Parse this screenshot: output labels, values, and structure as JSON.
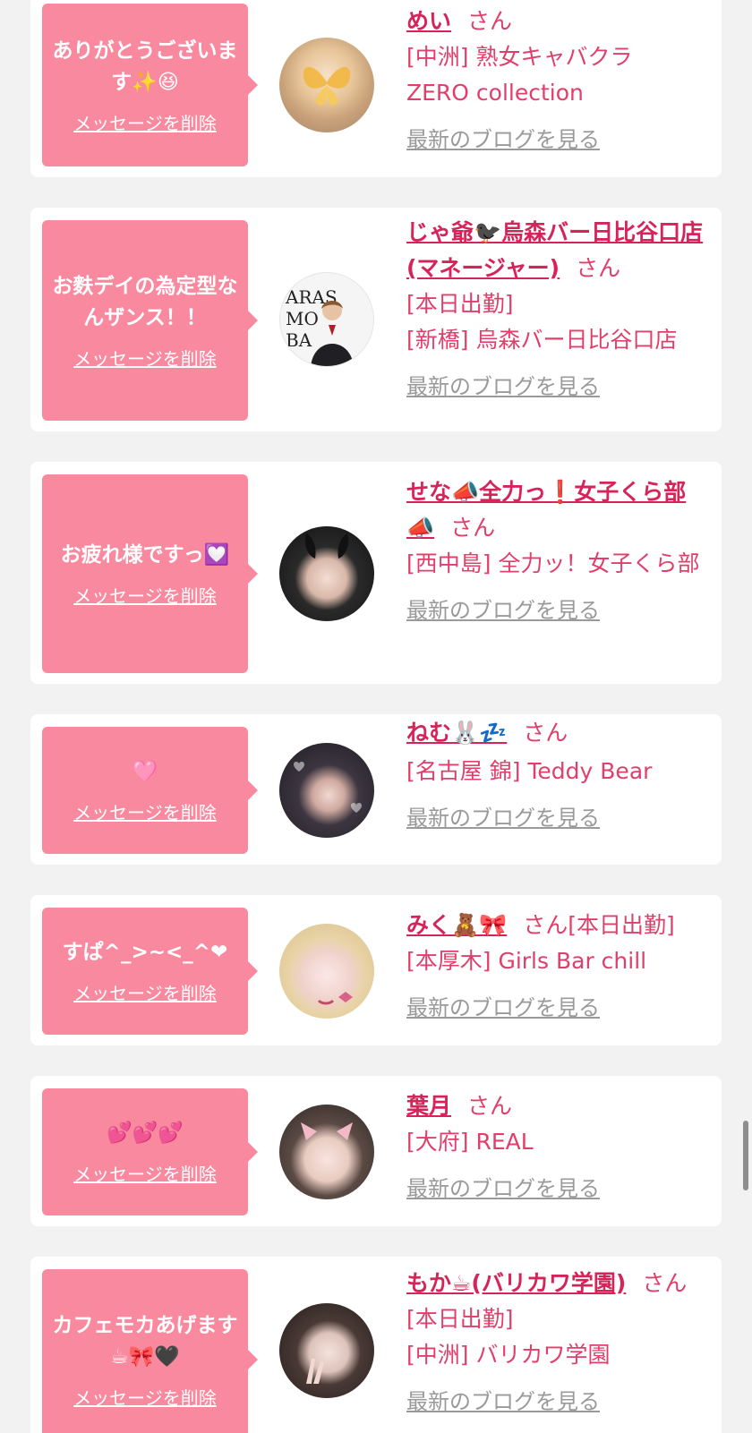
{
  "delete_label": "メッセージを削除",
  "blog_label": "最新のブログを見る",
  "san_label": "さん",
  "colors": {
    "bubble": "#f8899e",
    "name": "#d6245a",
    "shop": "#e03f6b",
    "blog": "#9a9a9a",
    "background": "#f2f2f2"
  },
  "messages": [
    {
      "text": "ありがとうございます✨😆",
      "name": "めい",
      "status": "",
      "lines": [
        "[中洲] 熟女キャバクラ",
        "ZERO collection"
      ],
      "avatar_icon": "avatar-photo-icon"
    },
    {
      "text": "お麩デイの為定型なんザンス！！",
      "name": "じゃ爺🐦‍⬛烏森バー日比谷口店(マネージャー)",
      "status": "[本日出勤]",
      "lines": [
        "[新橋] 烏森バー日比谷口店"
      ],
      "avatar_icon": "avatar-photo-icon"
    },
    {
      "text": "お疲れ様ですっ💟",
      "name": "せな📣全力っ❗女子くら部📣",
      "status": "",
      "lines": [
        "[西中島] 全力ッ！女子くら部"
      ],
      "avatar_icon": "avatar-photo-icon"
    },
    {
      "text": "🩷",
      "name": "ねむ🐰💤",
      "status": "",
      "lines": [
        "[名古屋 錦] Teddy Bear"
      ],
      "avatar_icon": "avatar-photo-icon"
    },
    {
      "text": "すぱ^_>~<_^❤",
      "name": "みく🧸🎀",
      "status": "[本日出勤]",
      "lines": [
        "[本厚木] Girls Bar chill"
      ],
      "avatar_icon": "avatar-photo-icon"
    },
    {
      "text": "💕💕💕",
      "name": "葉月",
      "status": "",
      "lines": [
        "[大府] REAL"
      ],
      "avatar_icon": "avatar-photo-icon"
    },
    {
      "text": "カフェモカあげます☕🎀🖤",
      "name": "もか☕(バリカワ学園)",
      "status": "[本日出勤]",
      "lines": [
        "[中洲] バリカワ学園"
      ],
      "avatar_icon": "avatar-photo-icon"
    }
  ]
}
